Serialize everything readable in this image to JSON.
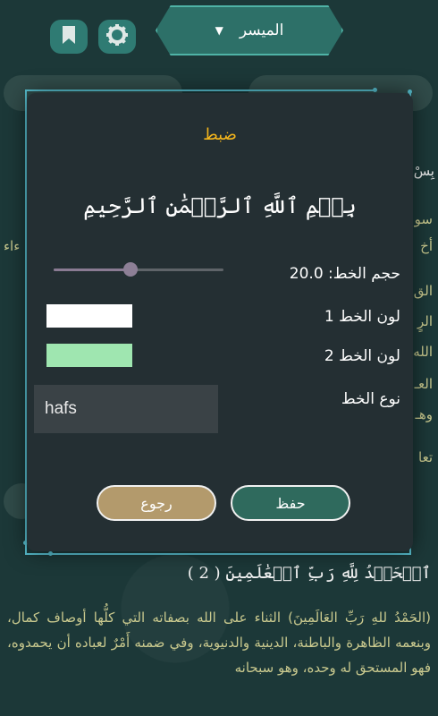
{
  "app": {
    "surah_selector": {
      "value": "الميسر"
    },
    "verse_2": "ٱلۡحَمۡدُ لِلَّهِ رَبِّ ٱلۡعَٰلَمِينَ ( 2 )",
    "tafsir_text": "(الحَمْدُ للهِ رَبِّ العَالَمِينَ) الثناء على الله بصفاته التي كلُّها أوصاف كمال، وبنعمه الظاهرة والباطنة، الدينية والدنيوية، وفي ضمنه أَمْرٌ لعباده أن يحمدوه، فهو المستحق له وحده، وهو سبحانه",
    "side_fragments": [
      "بِسْ",
      "سو",
      "أخ",
      "الق",
      "الرٍ",
      "الله",
      "العـ",
      "وهـ",
      "تعا",
      "ءاء"
    ]
  },
  "settings_dialog": {
    "title": "ضبط",
    "preview_text": "بِسۡمِ ٱللَّهِ ٱلرَّحۡمَٰنِ ٱلرَّحِيمِ",
    "font_size": {
      "label": "حجم الخط:",
      "value": "20.0",
      "slider_fraction": 0.45
    },
    "font_color_1": {
      "label": "لون الخط 1",
      "color": "#ffffff"
    },
    "font_color_2": {
      "label": "لون الخط 2",
      "color": "#9fe6b0"
    },
    "font_type": {
      "label": "نوع الخط",
      "value": "hafs"
    },
    "back_button": "رجوع",
    "save_button": "حفظ"
  },
  "colors": {
    "accent": "#f3b51c",
    "teal": "#2f7b73",
    "frame": "#58c0d1"
  }
}
